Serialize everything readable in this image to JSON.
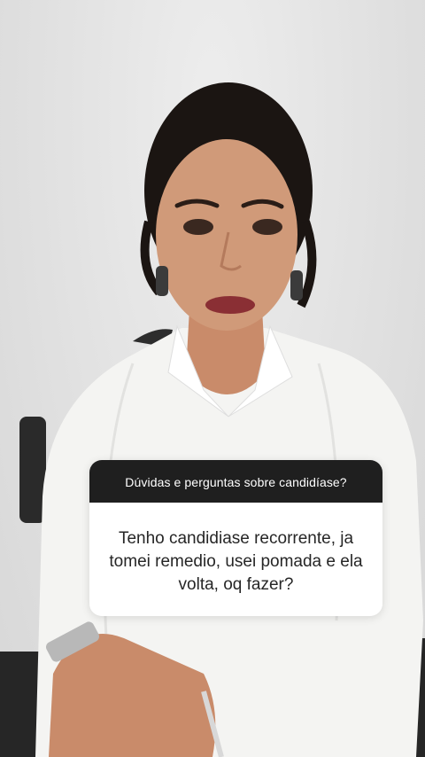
{
  "question_sticker": {
    "prompt": "Dúvidas e perguntas sobre candidíase?",
    "answer": "Tenho candidiase recorrente, ja tomei remedio, usei pomada e ela volta, oq fazer?"
  },
  "colors": {
    "sticker_header_bg": "#1f1f1f",
    "sticker_body_bg": "#ffffff",
    "background_wall": "#e3e3e3"
  }
}
